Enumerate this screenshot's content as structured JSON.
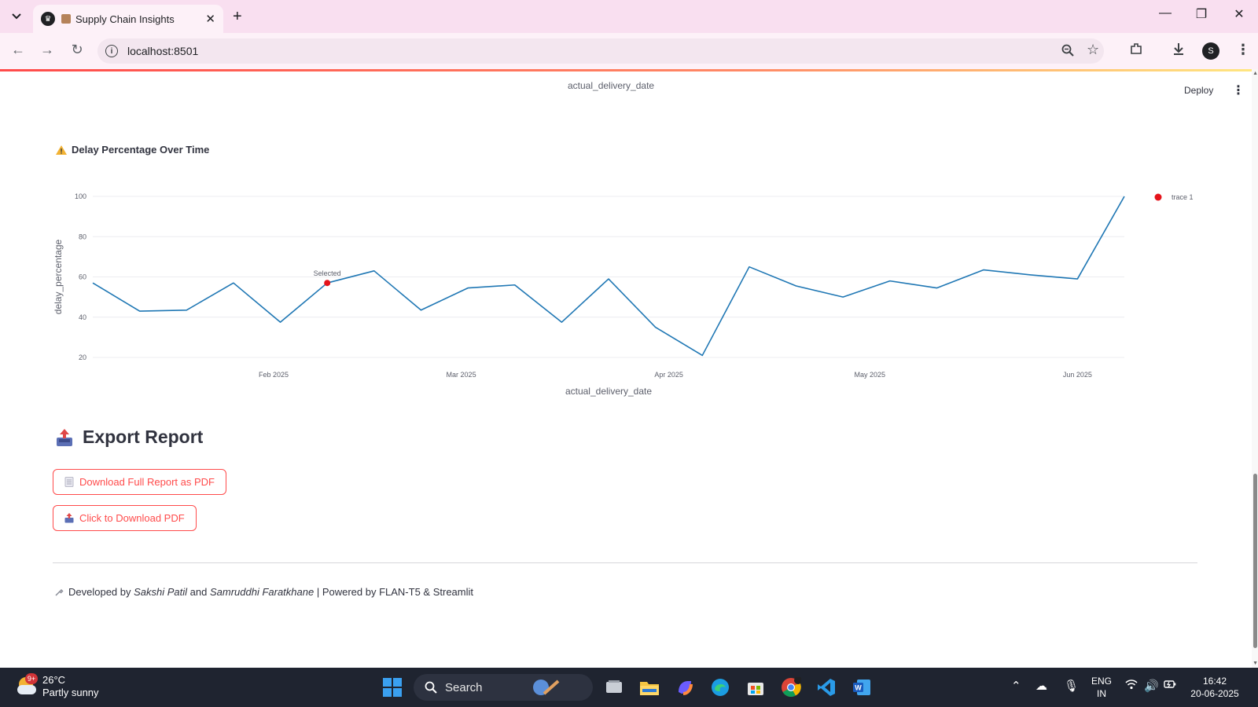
{
  "browser": {
    "tab_title": "Supply Chain Insights",
    "new_tab": "+",
    "url": "localhost:8501"
  },
  "app": {
    "deploy_label": "Deploy",
    "previous_chart_xlabel": "actual_delivery_date"
  },
  "chart_section": {
    "title": "Delay Percentage Over Time",
    "icon": "warning-icon"
  },
  "chart_data": {
    "type": "line",
    "xlabel": "actual_delivery_date",
    "ylabel": "delay_percentage",
    "ylim": [
      20,
      100
    ],
    "yticks": [
      20,
      40,
      60,
      80,
      100
    ],
    "xticks": [
      "Feb 2025",
      "Mar 2025",
      "Apr 2025",
      "May 2025",
      "Jun 2025"
    ],
    "grid": true,
    "legend_position": "top-right",
    "series": [
      {
        "name": "trace 1",
        "color": "#1f77b4",
        "x": [
          "2025-01-05",
          "2025-01-12",
          "2025-01-19",
          "2025-01-26",
          "2025-02-02",
          "2025-02-09",
          "2025-02-16",
          "2025-02-23",
          "2025-03-02",
          "2025-03-09",
          "2025-03-16",
          "2025-03-23",
          "2025-03-30",
          "2025-04-06",
          "2025-04-13",
          "2025-04-20",
          "2025-04-27",
          "2025-05-04",
          "2025-05-11",
          "2025-05-18",
          "2025-05-25",
          "2025-06-01",
          "2025-06-08"
        ],
        "values": [
          57,
          43,
          43.5,
          57,
          37.5,
          57,
          63,
          43.5,
          54.5,
          56,
          37.5,
          59,
          35,
          21,
          65,
          55.5,
          50,
          58,
          54.5,
          63.5,
          61,
          59,
          100
        ]
      }
    ],
    "selected_point": {
      "label": "Selected",
      "x": "2025-02-09",
      "value": 57,
      "color": "#e5141b"
    },
    "legend_marker_color": "#e5141b"
  },
  "export": {
    "title": "Export Report",
    "button_full_pdf": "Download Full Report as PDF",
    "button_click_pdf": "Click to Download PDF"
  },
  "footer": {
    "prefix": "Developed by ",
    "author1": "Sakshi Patil",
    "and": " and ",
    "author2": "Samruddhi Faratkhane",
    "suffix": " | Powered by FLAN-T5 & Streamlit"
  },
  "taskbar": {
    "temperature": "26°C",
    "condition": "Partly sunny",
    "weather_badge": "9+",
    "search_placeholder": "Search",
    "language_line1": "ENG",
    "language_line2": "IN",
    "time": "16:42",
    "date": "20-06-2025"
  },
  "colors": {
    "accent": "#ff4b4b",
    "line": "#1f77b4",
    "marker": "#e5141b"
  }
}
